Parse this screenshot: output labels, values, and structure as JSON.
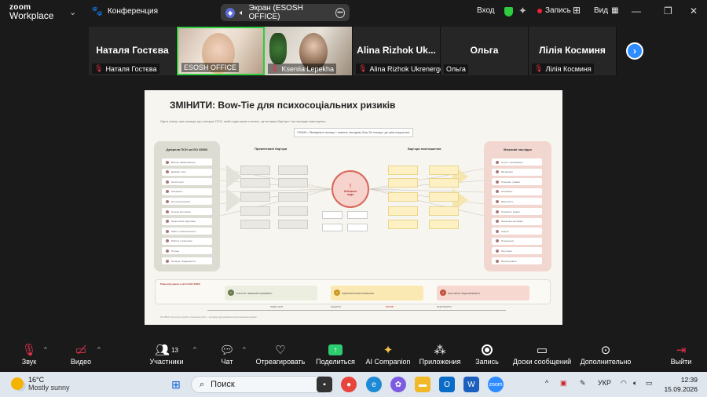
{
  "app": {
    "logo_line1": "zoom",
    "logo_line2": "Workplace",
    "meeting_label": "Конференция",
    "screen_share_label": "Экран (ESOSH OFFICE)",
    "join_label": "Вход",
    "record_label": "Запись",
    "view_label": "Вид"
  },
  "participants": [
    {
      "big_name": "Наталя Гостєва",
      "name": "Наталя Гостєва",
      "muted": true
    },
    {
      "big_name": "",
      "name": "ESOSH OFFICE",
      "muted": false
    },
    {
      "big_name": "",
      "name": "Kseniia Lepekha",
      "muted": true
    },
    {
      "big_name": "Alina Rizhok Uk...",
      "name": "Alina Rizhok Ukrenergo",
      "muted": true
    },
    {
      "big_name": "Ольга",
      "name": "Ольга",
      "muted": false
    },
    {
      "big_name": "Лілія Косминя",
      "name": "Лілія Косминя",
      "muted": true
    }
  ],
  "slide": {
    "title": "ЗМІНИТИ: Bow-Tie для психосоціальних ризиків",
    "subtitle": "Одна схема, яка показує що створює ПСН, який подія може статись, де вставка бар'єри і які наслідки зменшують",
    "formula": "РИЗИК = Ймовірність впливу × тяжкість наслідків   |   Bow-Tie показує, де саме втручатися",
    "left_column_title": "Джерела ПСН за ISO 45003",
    "left_items": [
      "Високе навантаження",
      "Дефіцит часу",
      "Нечіткі ролі",
      "Конфлікти",
      "Нестача ресурсів",
      "Низька автономія",
      "Недостатня підтримка",
      "Зміни / невизначеність",
      "Робота з клієнтами",
      "Погода",
      "Ізоляція / віддаленість"
    ],
    "preventive_title": "Превентивні бар'єри",
    "recovery_title": "Бар'єри пом'якшення",
    "event_line1": "Небажана",
    "event_line2": "подія",
    "right_column_title": "Можливі наслідки",
    "right_items": [
      "Стрес / виснаження",
      "Вигорання",
      "Помилки, травми",
      "Конфлікти",
      "Відсутність",
      "Плинність кадрів",
      "Зниження мотивації",
      "Скарги",
      "Порушення",
      "Репутація",
      "Втрата довіри"
    ],
    "bottom_title": "Рівні втручання у світлі ISO 45003",
    "cards": [
      {
        "num": "1",
        "label": "УСУНУТИ / ЗМЕНШИТИ ДЖЕРЕЛО",
        "color": "#eceee0",
        "num_color": "#6b7a4e"
      },
      {
        "num": "2",
        "label": "ПІДТРИМАТИ ВИСТОЮВАННЯ",
        "color": "#fbe9b4",
        "num_color": "#c99a26"
      },
      {
        "num": "3",
        "label": "РЕАГУВАТИ І ВІДНОВЛЮВАТИ",
        "color": "#f7d8d0",
        "num_color": "#c0533f"
      }
    ],
    "timeline": [
      "ПОДИ ЧАТИ",
      "ОЦІНИТИ",
      "ВПЛИВ",
      "МОНІТОРИТИ"
    ],
    "footnote": "ISO 45003: психологічне здоров'я та безпека на роботі — настанови щодо управління психосоціальними ризиками"
  },
  "toolbar": {
    "mute": "Звук",
    "video": "Видео",
    "participants": "Участники",
    "participants_count": "13",
    "chat": "Чат",
    "react": "Отреагировать",
    "share": "Поделиться",
    "ai": "AI Companion",
    "apps": "Приложения",
    "record": "Запись",
    "boards": "Доски сообщений",
    "more": "Дополнительно",
    "leave": "Выйти"
  },
  "taskbar": {
    "temp": "16°C",
    "weather": "Mostly sunny",
    "search_placeholder": "Поиск",
    "lang": "УКР",
    "time": "12:39",
    "date": "15.09.2026"
  },
  "colors": {
    "accent_blue": "#2d8cff",
    "active_speaker": "#2ecc40",
    "muted_red": "#e0334d",
    "share_green": "#2ecc71"
  }
}
